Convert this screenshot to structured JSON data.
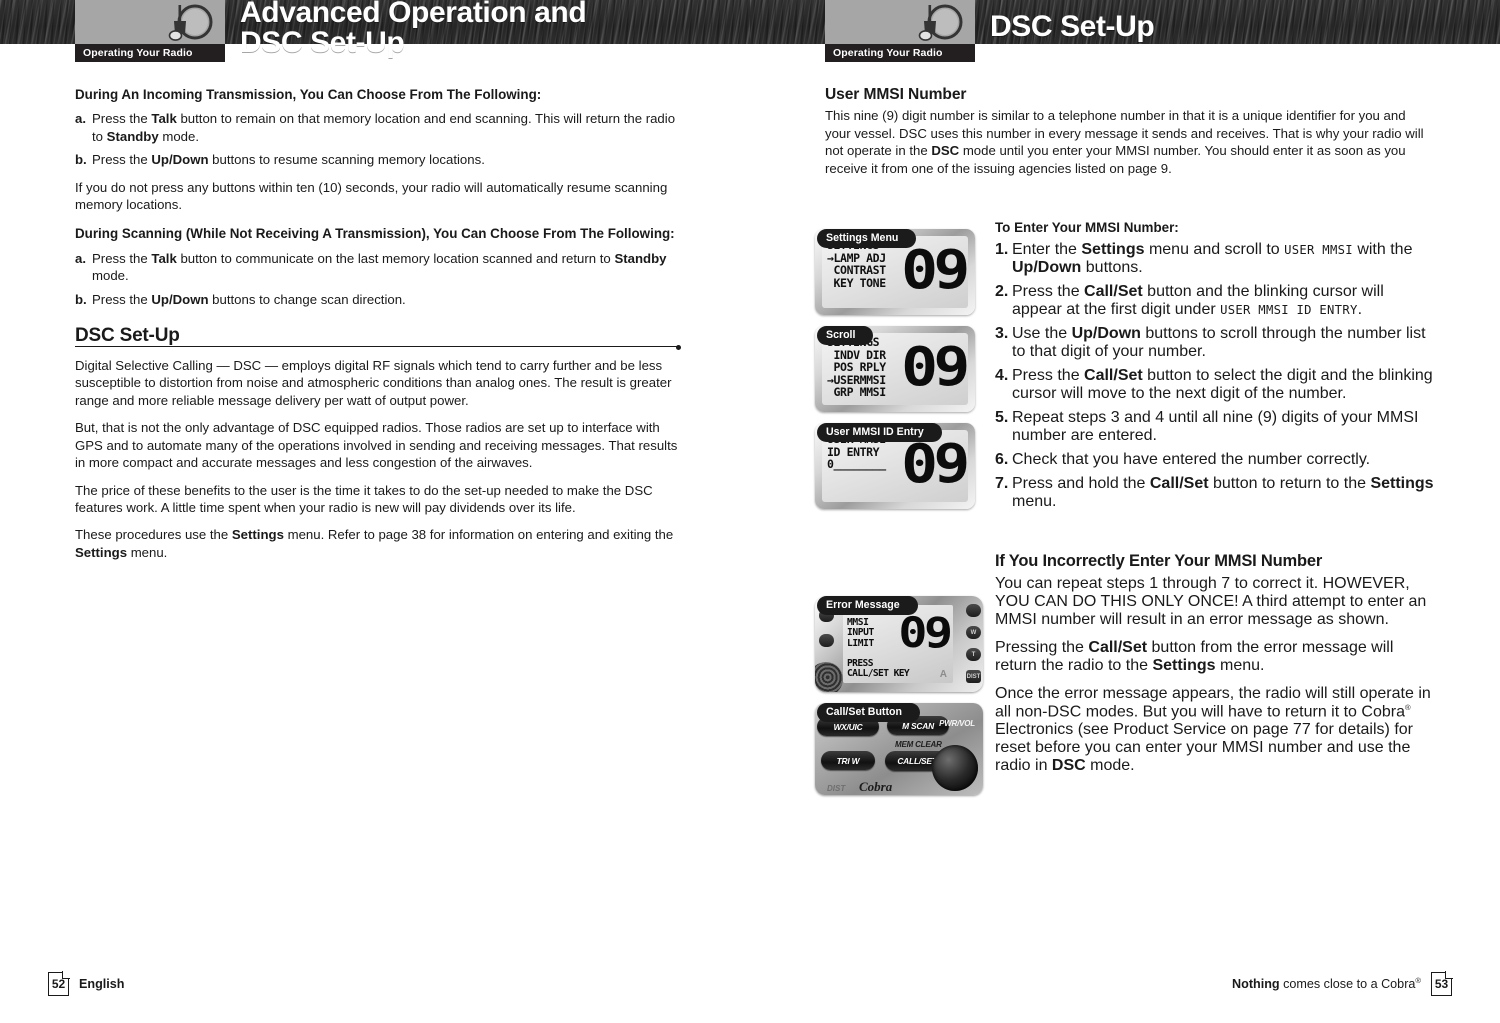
{
  "pages": {
    "left": {
      "tab_label": "Operating Your Radio",
      "chapter_title": "Advanced Operation and\nDSC Set-Up",
      "page_number": "52",
      "footer_language": "English",
      "heading_1": "During An Incoming Transmission, You Can Choose From The Following:",
      "list_1": [
        {
          "marker": "a.",
          "text_html": "Press the <b>Talk</b> button to remain on that memory location and end scanning. This will return the radio to <b>Standby</b> mode."
        },
        {
          "marker": "b.",
          "text_html": "Press the <b>Up/Down</b> buttons to resume scanning memory locations."
        }
      ],
      "para_1": "If you do not press any buttons within ten (10) seconds, your radio will automatically resume scanning memory locations.",
      "heading_2": "During Scanning (While Not Receiving A Transmission), You Can Choose From The Following:",
      "list_2": [
        {
          "marker": "a.",
          "text_html": "Press the <b>Talk</b> button to communicate on the last memory location scanned and return to <b>Standby</b> mode."
        },
        {
          "marker": "b.",
          "text_html": "Press the <b>Up/Down</b> buttons to change scan direction."
        }
      ],
      "section_title": "DSC Set-Up",
      "para_2": "Digital Selective Calling — DSC — employs digital RF signals which tend to carry further and be less susceptible to distortion from noise and atmospheric conditions than analog ones. The result is greater range and more reliable message delivery per watt of output power.",
      "para_3": "But, that is not the only advantage of DSC equipped radios. Those radios are set up to interface with GPS and to automate many of the operations involved in sending and receiving messages. That results in more compact and accurate messages and less congestion of the airwaves.",
      "para_4": "The price of these benefits to the user is the time it takes to do the set-up needed to make the DSC features work. A little time spent when your radio is new will pay dividends over its life.",
      "para_5_html": "These procedures use the <b>Settings</b> menu. Refer to page 38 for information on entering and exiting the <b>Settings</b> menu."
    },
    "right": {
      "tab_label": "Operating Your Radio",
      "chapter_title": "DSC Set-Up",
      "page_number": "53",
      "footer_tagline_bold": "Nothing",
      "footer_tagline_rest": " comes close to a Cobra",
      "footer_registered": "®",
      "heading_1": "User MMSI Number",
      "para_1_html": "This nine (9) digit number is similar to a telephone number in that it is a unique identifier for you and your vessel. DSC uses this number in every message it sends and receives. That is why your radio will not operate in the <b>DSC</b> mode until you enter your MMSI number. You should enter it as soon as you receive it from one of the issuing agencies listed on page 9.",
      "heading_2": "To Enter Your MMSI Number:",
      "steps": [
        {
          "marker": "1.",
          "text_html": "Enter the <b>Settings</b> menu and scroll to <span class=\"lcdtxt\">USER MMSI</span> with the <b>Up/Down</b> buttons."
        },
        {
          "marker": "2.",
          "text_html": "Press the <b>Call/Set</b> button and the blinking cursor will appear at the first digit under <span class=\"lcdtxt\">USER MMSI ID ENTRY</span>."
        },
        {
          "marker": "3.",
          "text_html": "Use the <b>Up/Down</b> buttons to scroll through the number list to that digit of your number."
        },
        {
          "marker": "4.",
          "text_html": "Press the <b>Call/Set</b> button to select the digit and the blinking cursor will move to the next digit of the number."
        },
        {
          "marker": "5.",
          "text_html": "Repeat steps 3 and 4 until all nine (9) digits of your MMSI number are entered."
        },
        {
          "marker": "6.",
          "text_html": "Check that you have entered the number correctly."
        },
        {
          "marker": "7.",
          "text_html": "Press and hold the <b>Call/Set</b> button to return to the <b>Settings</b> menu."
        }
      ],
      "heading_3": "If You Incorrectly Enter Your MMSI Number",
      "para_2": "You can repeat steps 1 through 7 to correct it. HOWEVER, YOU CAN DO THIS ONLY ONCE! A third attempt to enter an MMSI number will result in an error message as shown.",
      "para_3_html": "Pressing the <b>Call/Set</b> button from the error message will return the radio to the <b>Settings</b> menu.",
      "para_4_html": "Once the error message appears, the radio will still operate in all non-DSC modes. But you will have to return it to Cobra<sup class=\"reg\">®</sup> Electronics (see Product Service on page 77 for details) for reset before you can enter your MMSI number and use the radio in <b>DSC</b> mode.",
      "figures": [
        {
          "caption": "Settings Menu",
          "lcd_lines": "SETTINGS\n→LAMP ADJ\n CONTRAST\n KEY TONE",
          "segment": "09"
        },
        {
          "caption": "Scroll",
          "lcd_lines": "SETTINGS\n INDV DIR\n POS RPLY\n→USERMMSI\n GRP MMSI",
          "segment": "09"
        },
        {
          "caption": "User MMSI ID Entry",
          "lcd_lines": "USER MMSI\nID ENTRY\n0________",
          "segment": "09"
        }
      ],
      "error_figure": {
        "caption": "Error Message",
        "lcd_lines": "ERROR\nMMSI\nINPUT\nLIMIT",
        "lcd_lines_2": "PRESS\nCALL/SET KEY",
        "segment": "09",
        "annunciator": "A",
        "side_buttons": [
          "W",
          "T",
          "DIST"
        ]
      },
      "button_figure": {
        "caption": "Call/Set Button",
        "buttons": [
          "WX/UIC",
          "M SCAN",
          "TRI W",
          "CALL/SET"
        ],
        "labels": [
          "MEM CLEAR",
          "PWR/VOL",
          "DIST"
        ],
        "brand": "Cobra"
      }
    }
  },
  "colors": {
    "ink": "#1a1a1a",
    "header_band": "#2b2b2b",
    "header_plate": "#a6a6a6",
    "tab_bg": "#231f20"
  }
}
